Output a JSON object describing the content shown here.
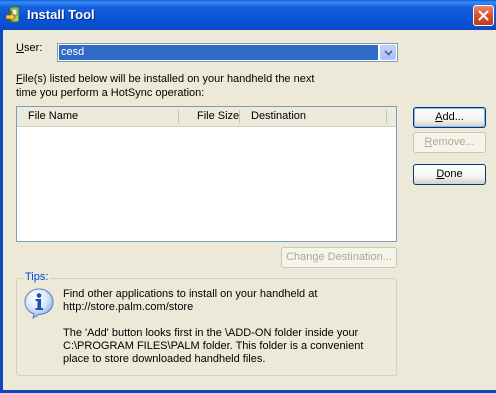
{
  "window": {
    "title": "Install Tool"
  },
  "user": {
    "label_underline": "U",
    "label_rest": "ser:",
    "value": "cesd"
  },
  "instructions": {
    "line1_underline": "F",
    "line1_rest": "ile(s) listed below will be installed on your handheld the next",
    "line2": "time you perform a HotSync operation:"
  },
  "file_list": {
    "columns": [
      "File Name",
      "File Size",
      "Destination"
    ],
    "rows": []
  },
  "buttons": {
    "add_underline": "A",
    "add_rest": "dd...",
    "remove_underline": "R",
    "remove_rest": "emove...",
    "done_underline": "D",
    "done_rest": "one",
    "change_destination": "Change Destination..."
  },
  "tips": {
    "legend": "Tips:",
    "tip1_line1": "Find other applications to install on your handheld at",
    "tip1_line2": "http://store.palm.com/store",
    "tip2_line1": "The 'Add' button looks first in the \\ADD-ON folder inside your",
    "tip2_line2": "C:\\PROGRAM FILES\\PALM folder. This folder is a convenient",
    "tip2_line3": "place to store downloaded handheld files."
  },
  "colors": {
    "titlebar_blue": "#0a52d6",
    "selection_blue": "#316ac5",
    "close_red": "#d4502e",
    "dialog_bg": "#ece9d8",
    "tips_legend_blue": "#0046d5"
  },
  "icons": {
    "app": "install-tool-icon",
    "close": "close-icon",
    "dropdown": "chevron-down-icon",
    "info": "info-icon"
  }
}
